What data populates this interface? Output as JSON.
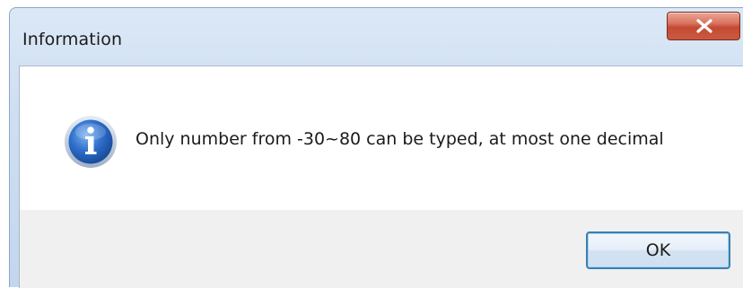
{
  "window": {
    "title": "Information",
    "close_icon": "close-x-icon"
  },
  "message": {
    "icon": "information-icon",
    "text": "Only number from -30~80 can be typed, at most one decimal"
  },
  "buttons": {
    "ok_label": "OK"
  },
  "colors": {
    "titlebar": "#cfdff2",
    "close_button": "#c9543c",
    "content_background": "#ffffff",
    "button_area": "#f0f0f0",
    "info_icon": "#1f5fb8",
    "ok_border": "#3c7fb1"
  }
}
